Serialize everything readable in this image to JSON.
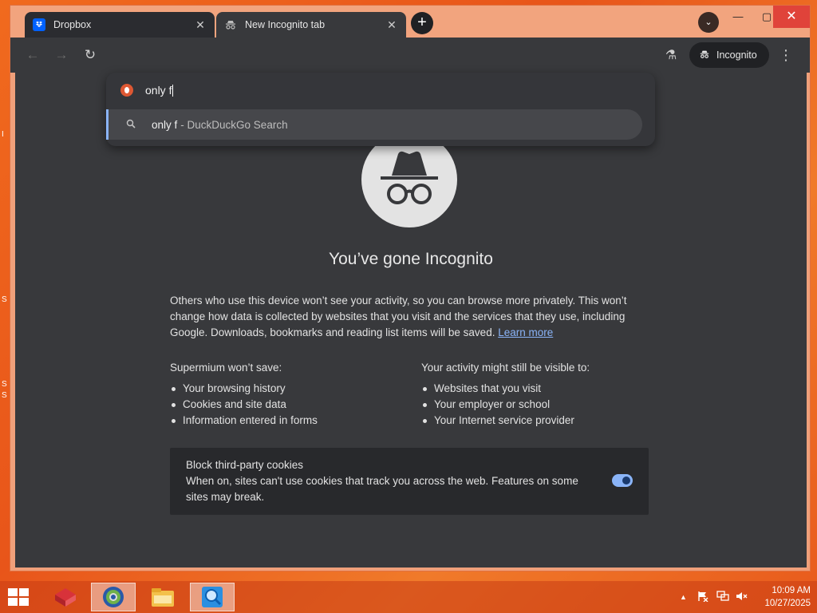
{
  "desktop": {
    "edge_frags": [
      "I",
      "S",
      "S",
      "S"
    ]
  },
  "tabs": [
    {
      "title": "Dropbox",
      "icon": "dropbox-icon",
      "close": "✕"
    },
    {
      "title": "New Incognito tab",
      "icon": "incognito-icon",
      "close": "✕"
    }
  ],
  "titlebar": {
    "new_tab": "+",
    "tab_search": "⌄",
    "minimize": "—",
    "maximize": "▢",
    "close": "✕"
  },
  "toolbar": {
    "back": "←",
    "forward": "→",
    "reload": "↻",
    "labs": "⚗",
    "incognito_label": "Incognito",
    "menu": "⋮"
  },
  "omnibox": {
    "text": "only f",
    "suggestion": {
      "query": "only f",
      "description": "- DuckDuckGo Search"
    },
    "engine_color": "#de5833"
  },
  "content": {
    "title": "You’ve gone Incognito",
    "intro": "Others who use this device won’t see your activity, so you can browse more privately. This won’t change how data is collected by websites that you visit and the services that they use, including Google. Downloads, bookmarks and reading list items will be saved.",
    "learn_more": "Learn more",
    "wont_save": {
      "heading": "Supermium won’t save:",
      "items": [
        "Your browsing history",
        "Cookies and site data",
        "Information entered in forms"
      ]
    },
    "visible_to": {
      "heading": "Your activity might still be visible to:",
      "items": [
        "Websites that you visit",
        "Your employer or school",
        "Your Internet service provider"
      ]
    },
    "cookies": {
      "title": "Block third-party cookies",
      "description": "When on, sites can't use cookies that track you across the web. Features on some sites may break.",
      "enabled": true
    }
  },
  "taskbar": {
    "clock_time": "10:09 AM",
    "clock_date": "10/27/2025",
    "tray_up": "▲"
  },
  "colors": {
    "accent": "#8ab4f8",
    "close_red": "#e0433a",
    "content_bg": "#38393c"
  }
}
